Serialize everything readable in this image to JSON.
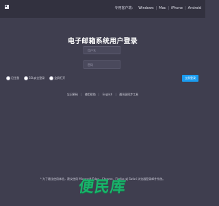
{
  "topbar": {
    "clients_label": "专用客户端:",
    "clients": [
      "Windows",
      "Mac",
      "iPhone",
      "Android"
    ]
  },
  "login": {
    "title": "电子邮箱系统用户登录",
    "username_placeholder": "用户名",
    "password_placeholder": "密码",
    "options": [
      "记住我",
      "SSL安全登录",
      "全屏打开"
    ],
    "submit_label": "立即登录"
  },
  "links": [
    "忘记密码",
    "使用帮助",
    "English",
    "通讯录同步工具"
  ],
  "notice": "* 为了最佳使用体验，建议使用 Microsoft Edge、Chrome、Firefox 或 Safari 浏览器登录邮件系统。",
  "watermark": "便民库",
  "colors": {
    "background": "#3f3e4f",
    "topbar": "#32313f",
    "accent": "#1a9cf0",
    "watermark": "#19b36a"
  }
}
